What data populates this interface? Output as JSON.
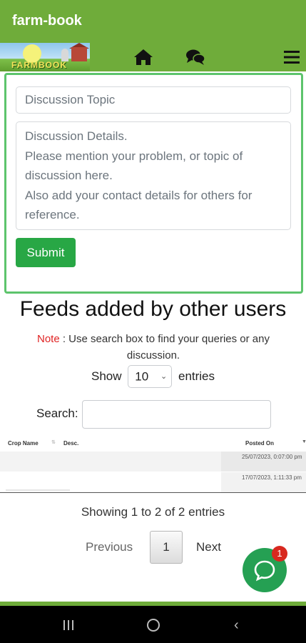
{
  "app": {
    "title": "farm-book"
  },
  "nav": {
    "logo_text": "FARMBOOK",
    "icons": [
      "home-icon",
      "chat-icon",
      "menu-icon"
    ]
  },
  "form": {
    "topic_placeholder": "Discussion Topic",
    "details_placeholder": "Discussion Details.\nPlease mention your problem, or topic of discussion here.\nAlso add your contact details for others for reference.",
    "submit_label": "Submit"
  },
  "feeds": {
    "heading": "Feeds added by other users",
    "note_label": "Note",
    "note_text": " : Use search box to find your queries or any discussion.",
    "show_label": "Show",
    "entries_value": "10",
    "entries_label": "entries",
    "search_label": "Search:",
    "search_value": "",
    "columns": [
      "Crop Name",
      "Desc.",
      "Posted On"
    ],
    "rows": [
      {
        "posted_on": "25/07/2023, 0:07:00 pm"
      },
      {
        "posted_on": "17/07/2023, 1:11:33 pm"
      }
    ],
    "info": "Showing 1 to 2 of 2 entries",
    "pagination": {
      "previous": "Previous",
      "page": "1",
      "next": "Next"
    }
  },
  "chat_widget": {
    "badge": "1"
  },
  "colors": {
    "appbar": "#6fac3a",
    "card_border": "#5dc46c",
    "submit": "#28a745",
    "note_label": "#e02424",
    "chat_fab": "#25a053",
    "badge": "#d8281f"
  }
}
